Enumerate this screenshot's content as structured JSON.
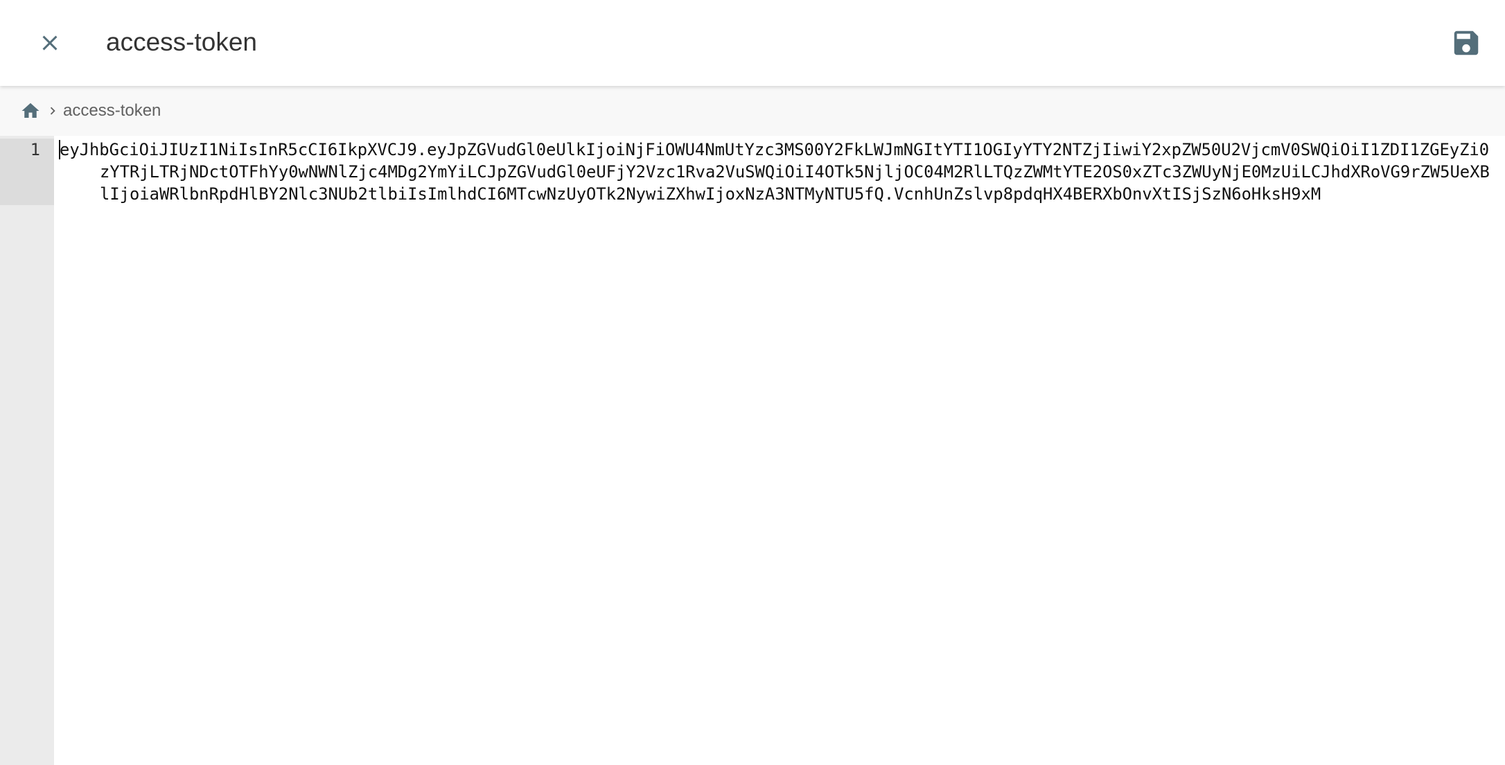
{
  "header": {
    "title": "access-token",
    "close_icon": "close-icon",
    "save_icon": "floppy-disk-icon"
  },
  "breadcrumb": {
    "home_icon": "home-icon",
    "separator_icon": "chevron-right-icon",
    "items": [
      "access-token"
    ]
  },
  "editor": {
    "line_numbers": [
      "1"
    ],
    "lines": [
      {
        "segments": [
          "eyJhbGciOiJIUzI1NiIsInR5cCI6IkpXVCJ9.eyJpZGVudGl0eUlkIjoiNjFiOWU4NmUtYzc3MS00Y2FkLWJmNGItYTI1OGIyYTY2NTZjIiwiY2xpZW50U2VjcmV0SWQiOiI1ZDI1ZGEyZi0",
          "zYTRjLTRjNDctOTFhYy0wNWNlZjc4MDg2YmYiLCJpZGVudGl0eUFjY2Vzc1Rva2VuSWQiOiI4OTk5NjljOC04M2RlLTQzZWMtYTE2OS0xZTc3ZWUyNjE0MzUiLCJhdXRoVG9rZW5UeXB",
          "lIjoiaWRlbnRpdHlBY2Nlc3NUb2tlbiIsImlhdCI6MTcwNzUyOTk2NywiZXhwIjoxNzA3NTMyNTU5fQ.VcnhUnZslvp8pdqHX4BERXbOnvXtISjSzN6oHksH9xM"
        ]
      }
    ]
  },
  "colors": {
    "header_bg": "#ffffff",
    "breadcrumb_bg": "#f8f8f8",
    "gutter_bg": "#ebebeb",
    "gutter_active_bg": "#dcdcdc",
    "icon_color": "#546e7a"
  }
}
